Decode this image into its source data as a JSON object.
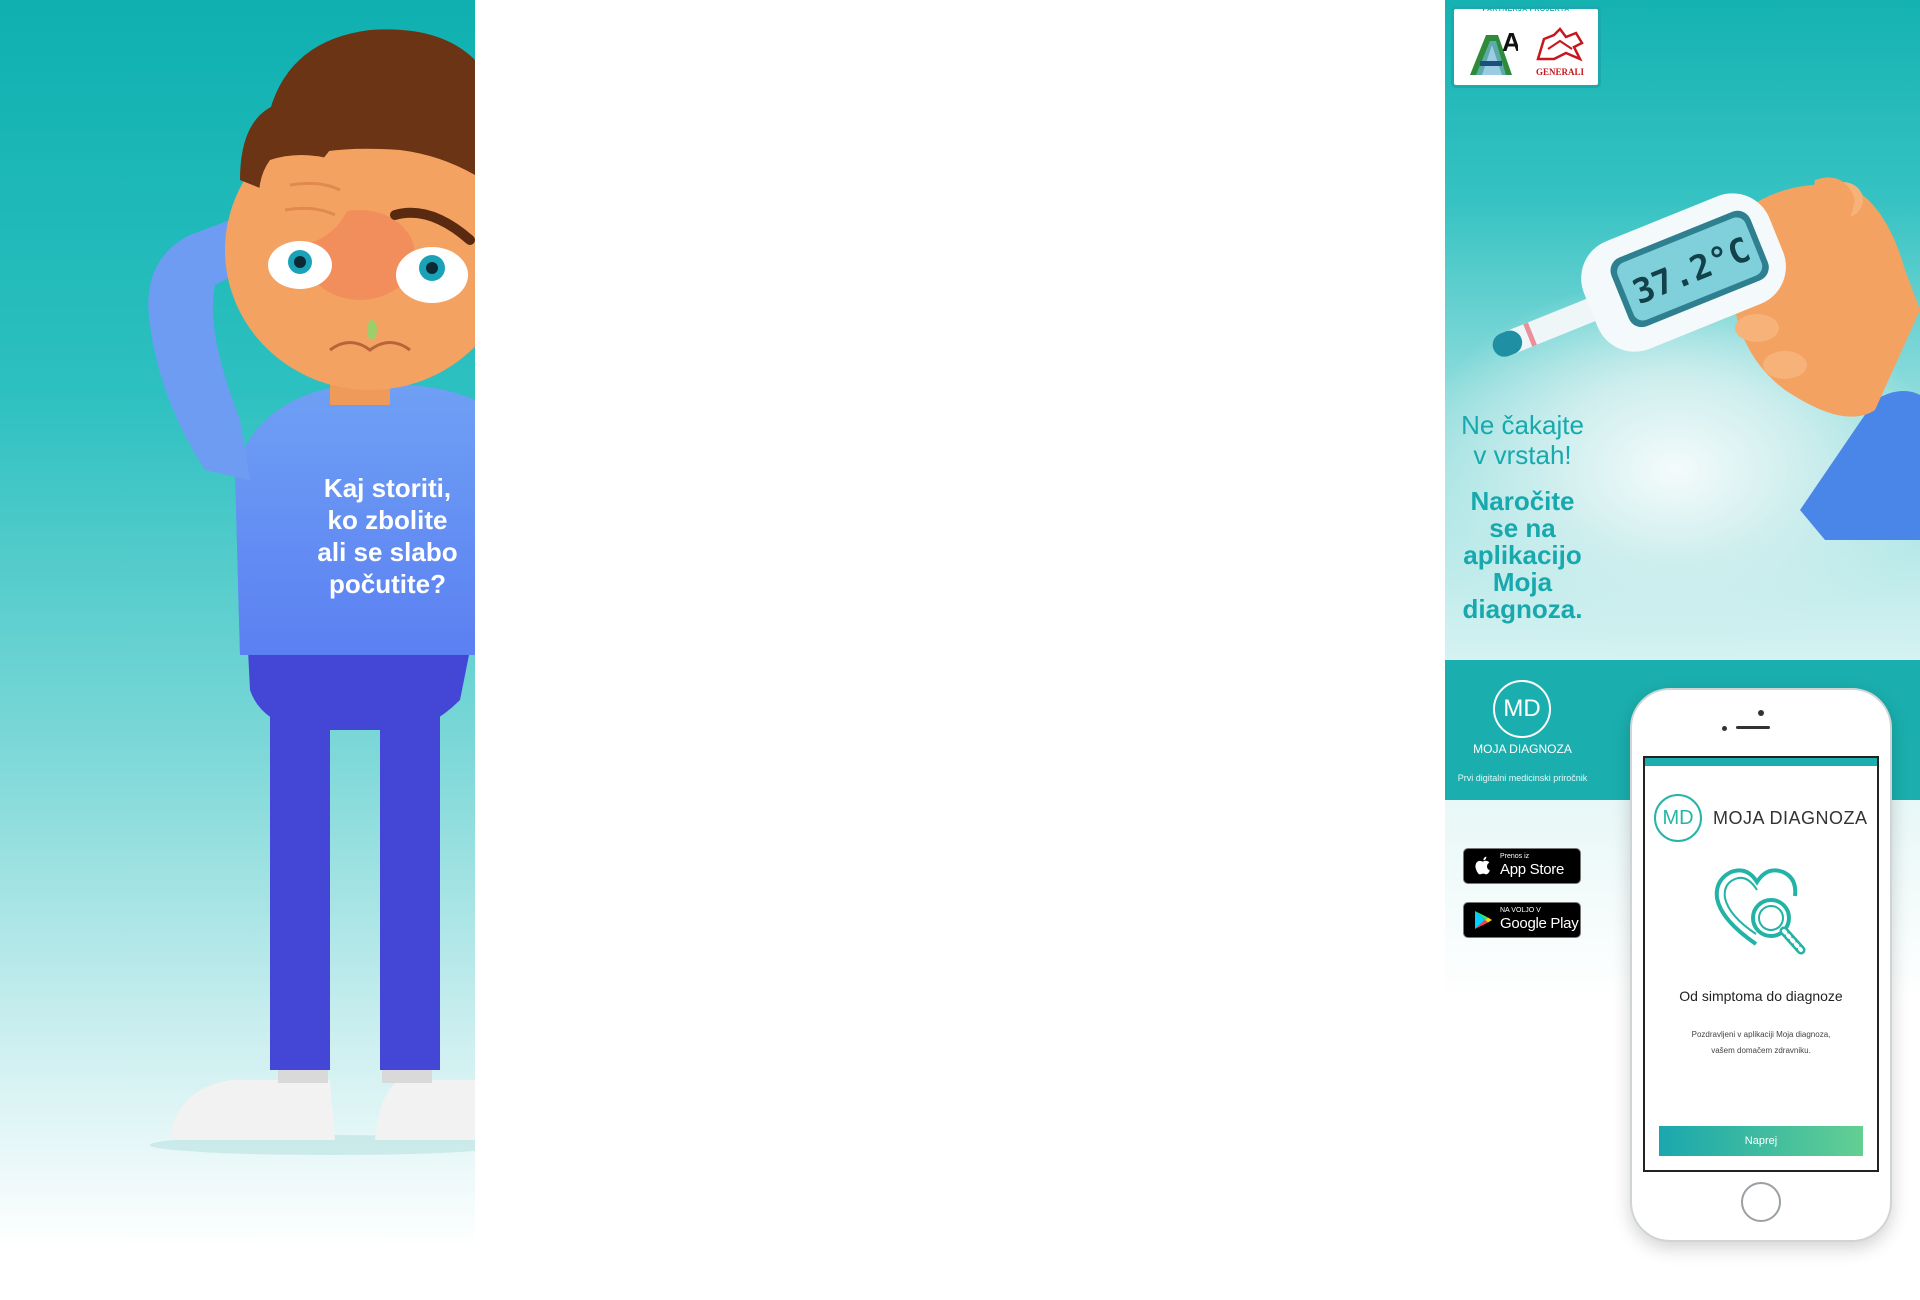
{
  "left_banner": {
    "headline_lines": [
      "Kaj storiti,",
      "ko zbolite",
      "ali se slabo",
      "počutite?"
    ]
  },
  "right_banner": {
    "partners_label": "PARTNERJA PROJEKTA",
    "partner_a1": "A1",
    "partner_generali": "GENERALI",
    "thermometer_reading": "37.2°C",
    "message_lines": [
      "Ne čakajte",
      "v vrstah!"
    ],
    "cta_lines": [
      "Naročite",
      "se na",
      "aplikacijo",
      "Moja",
      "diagnoza."
    ],
    "brand_initials": "MD",
    "brand_name": "MOJA DIAGNOZA",
    "brand_tagline": "Prvi digitalni medicinski priročnik",
    "app_store": {
      "small": "Prenos iz",
      "big": "App Store"
    },
    "google_play": {
      "small": "NA VOLJO V",
      "big": "Google Play"
    },
    "phone_screen": {
      "logo_initials": "MD",
      "logo_name": "MOJA DIAGNOZA",
      "title": "Od simptoma do diagnoze",
      "desc_line1": "Pozdravljeni v aplikaciji Moja diagnoza,",
      "desc_line2": "vašem domačem zdravniku.",
      "button": "Naprej"
    }
  },
  "colors": {
    "teal": "#1aafae",
    "shirt": "#5b8bf0",
    "pants": "#4447d6",
    "skin": "#f4a261",
    "hair": "#6b3414",
    "generali_red": "#c7161d"
  }
}
